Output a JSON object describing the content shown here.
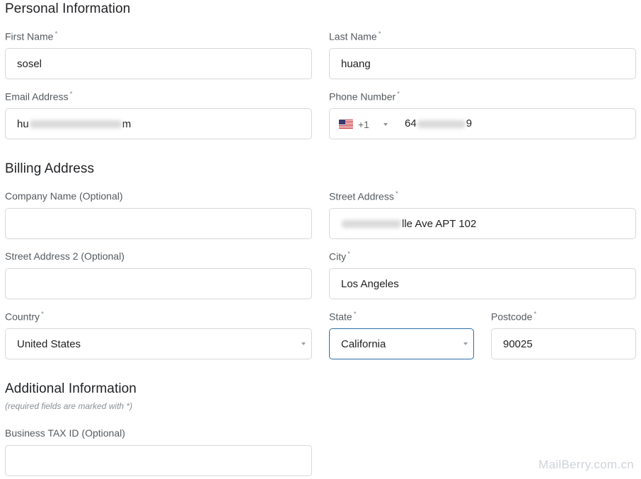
{
  "personal": {
    "title": "Personal Information",
    "first_name": {
      "label": "First Name",
      "value": "sosel"
    },
    "last_name": {
      "label": "Last Name",
      "value": "huang"
    },
    "email": {
      "label": "Email Address",
      "value_start": "hu",
      "value_end": "m"
    },
    "phone": {
      "label": "Phone Number",
      "country_code": "+1",
      "flag": "us-flag-icon",
      "value_start": "64",
      "value_end": "9"
    },
    "required_marker": "*"
  },
  "billing": {
    "title": "Billing Address",
    "company": {
      "label": "Company Name (Optional)",
      "value": ""
    },
    "street": {
      "label": "Street Address",
      "value_end": "lle Ave APT 102"
    },
    "street2": {
      "label": "Street Address 2 (Optional)",
      "value": ""
    },
    "city": {
      "label": "City",
      "value": "Los Angeles"
    },
    "country": {
      "label": "Country",
      "value": "United States"
    },
    "state": {
      "label": "State",
      "value": "California"
    },
    "postcode": {
      "label": "Postcode",
      "value": "90025"
    }
  },
  "additional": {
    "title": "Additional Information",
    "note": "(required fields are marked with *)",
    "tax_id": {
      "label": "Business TAX ID (Optional)",
      "value": ""
    }
  },
  "watermark": "MailBerry.com.cn",
  "colors": {
    "focus_border": "#2e6ea6",
    "field_border": "#d5d7da"
  }
}
